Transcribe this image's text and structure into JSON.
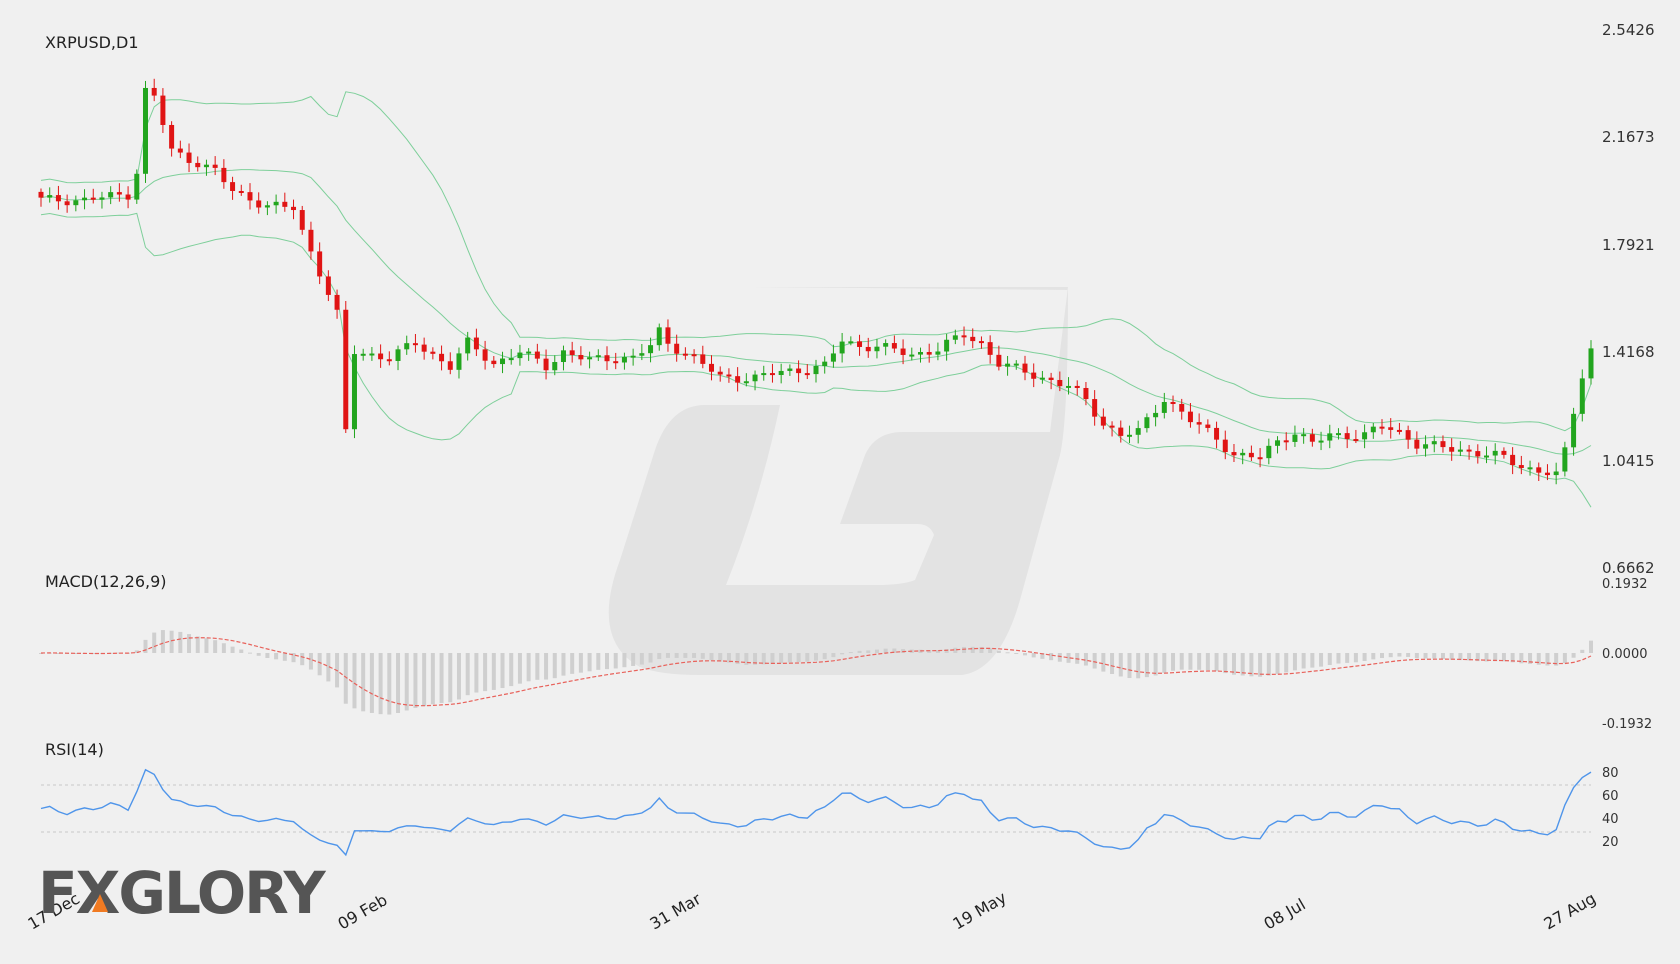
{
  "colors": {
    "bull": "#22a51e",
    "bear": "#e01414",
    "bollinger": "#7ecf9a",
    "macd_signal": "#e8625b",
    "macd_hist": "#cfcfcf",
    "rsi_line": "#4f95ea",
    "rsi_levels": "#c9c9c9",
    "watermark": "#e3e3e3",
    "logo": "#555555",
    "logo_accent": "#f07a22"
  },
  "logo": {
    "text": "FXGLORY"
  },
  "chart_data": [
    {
      "type": "candlestick",
      "title": "XRPUSD,D1",
      "y_ticks": [
        "2.5426",
        "2.1673",
        "1.7921",
        "1.4168",
        "1.0415",
        "0.6662"
      ],
      "ylim": [
        0.6662,
        2.5426
      ],
      "x_ticks": [
        {
          "label": "17 Dec",
          "index": 0
        },
        {
          "label": "09 Feb",
          "index": 35
        },
        {
          "label": "31 Mar",
          "index": 71
        },
        {
          "label": "19 May",
          "index": 106
        },
        {
          "label": "08 Jul",
          "index": 142
        },
        {
          "label": "27 Aug",
          "index": 177
        }
      ],
      "candle_count": 179,
      "anchors_close": [
        [
          0,
          1.95
        ],
        [
          5,
          1.95
        ],
        [
          10,
          1.97
        ],
        [
          11,
          2.05
        ],
        [
          12,
          2.33
        ],
        [
          13,
          2.31
        ],
        [
          15,
          2.12
        ],
        [
          18,
          2.08
        ],
        [
          20,
          2.05
        ],
        [
          22,
          1.98
        ],
        [
          26,
          1.93
        ],
        [
          29,
          1.92
        ],
        [
          30,
          1.84
        ],
        [
          32,
          1.7
        ],
        [
          34,
          1.55
        ],
        [
          35,
          1.14
        ],
        [
          36,
          1.42
        ],
        [
          40,
          1.4
        ],
        [
          43,
          1.45
        ],
        [
          47,
          1.37
        ],
        [
          49,
          1.45
        ],
        [
          52,
          1.38
        ],
        [
          55,
          1.42
        ],
        [
          58,
          1.37
        ],
        [
          60,
          1.42
        ],
        [
          63,
          1.39
        ],
        [
          66,
          1.4
        ],
        [
          68,
          1.4
        ],
        [
          70,
          1.44
        ],
        [
          71,
          1.49
        ],
        [
          72,
          1.45
        ],
        [
          75,
          1.4
        ],
        [
          78,
          1.33
        ],
        [
          82,
          1.33
        ],
        [
          85,
          1.35
        ],
        [
          88,
          1.36
        ],
        [
          90,
          1.37
        ],
        [
          92,
          1.46
        ],
        [
          94,
          1.44
        ],
        [
          96,
          1.44
        ],
        [
          100,
          1.41
        ],
        [
          103,
          1.43
        ],
        [
          106,
          1.48
        ],
        [
          108,
          1.45
        ],
        [
          110,
          1.38
        ],
        [
          115,
          1.33
        ],
        [
          118,
          1.3
        ],
        [
          120,
          1.25
        ],
        [
          122,
          1.17
        ],
        [
          124,
          1.13
        ],
        [
          126,
          1.14
        ],
        [
          129,
          1.26
        ],
        [
          132,
          1.18
        ],
        [
          135,
          1.12
        ],
        [
          137,
          1.06
        ],
        [
          140,
          1.05
        ],
        [
          142,
          1.11
        ],
        [
          144,
          1.14
        ],
        [
          146,
          1.1
        ],
        [
          148,
          1.13
        ],
        [
          152,
          1.13
        ],
        [
          154,
          1.16
        ],
        [
          156,
          1.14
        ],
        [
          158,
          1.1
        ],
        [
          162,
          1.08
        ],
        [
          165,
          1.07
        ],
        [
          168,
          1.05
        ],
        [
          170,
          1.02
        ],
        [
          173,
          1.0
        ],
        [
          174,
          0.99
        ],
        [
          175,
          1.07
        ],
        [
          176,
          1.21
        ],
        [
          177,
          1.34
        ],
        [
          178,
          1.43
        ],
        [
          179,
          1.46
        ],
        [
          180,
          1.41
        ],
        [
          181,
          1.43
        ]
      ],
      "indicators": [
        "Bollinger Bands (20,2)"
      ]
    },
    {
      "type": "bar",
      "title": "MACD(12,26,9)",
      "y_ticks": [
        "0.1932",
        "0.0000",
        "-0.1932"
      ],
      "ylim": [
        -0.1932,
        0.1932
      ],
      "series": [
        {
          "values_source": "computed from price: MACD histogram",
          "style": "bars"
        },
        {
          "values_source": "computed from price: MACD signal",
          "style": "dashed line"
        }
      ]
    },
    {
      "type": "line",
      "title": "RSI(14)",
      "y_ticks": [
        "80",
        "60",
        "40",
        "20"
      ],
      "ylim": [
        0,
        100
      ],
      "levels": [
        70,
        30
      ]
    }
  ]
}
